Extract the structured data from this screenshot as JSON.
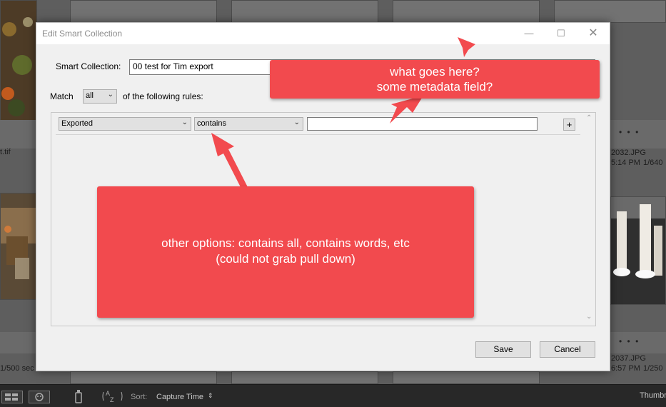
{
  "background": {
    "captions": {
      "left_top": "t.tif",
      "left_bottom": "1/500 sec",
      "right_top_name": "2032.JPG",
      "right_top_time": "5:14 PM",
      "right_top_shutter": "1/640",
      "right_bottom_name": "2037.JPG",
      "right_bottom_time": "6:57 PM",
      "right_bottom_shutter": "1/250"
    }
  },
  "toolbar": {
    "sort_label": "Sort:",
    "sort_value": "Capture Time",
    "thumb_label": "Thumbn"
  },
  "dialog": {
    "title": "Edit Smart Collection",
    "name_label": "Smart Collection:",
    "name_value": "00 test for Tim export",
    "match_label": "Match",
    "match_value": "all",
    "match_suffix": "of the following rules:",
    "rule": {
      "field": "Exported",
      "operator": "contains",
      "value": ""
    },
    "add_rule_label": "+",
    "save_label": "Save",
    "cancel_label": "Cancel"
  },
  "annotations": {
    "top_note_line1": "what goes here?",
    "top_note_line2": "some metadata field?",
    "big_note_line1": "other options: contains all, contains words, etc",
    "big_note_line2": "(could not grab pull down)"
  },
  "colors": {
    "annotation": "#f24a4e",
    "dialog_bg": "#f0f0f0"
  }
}
